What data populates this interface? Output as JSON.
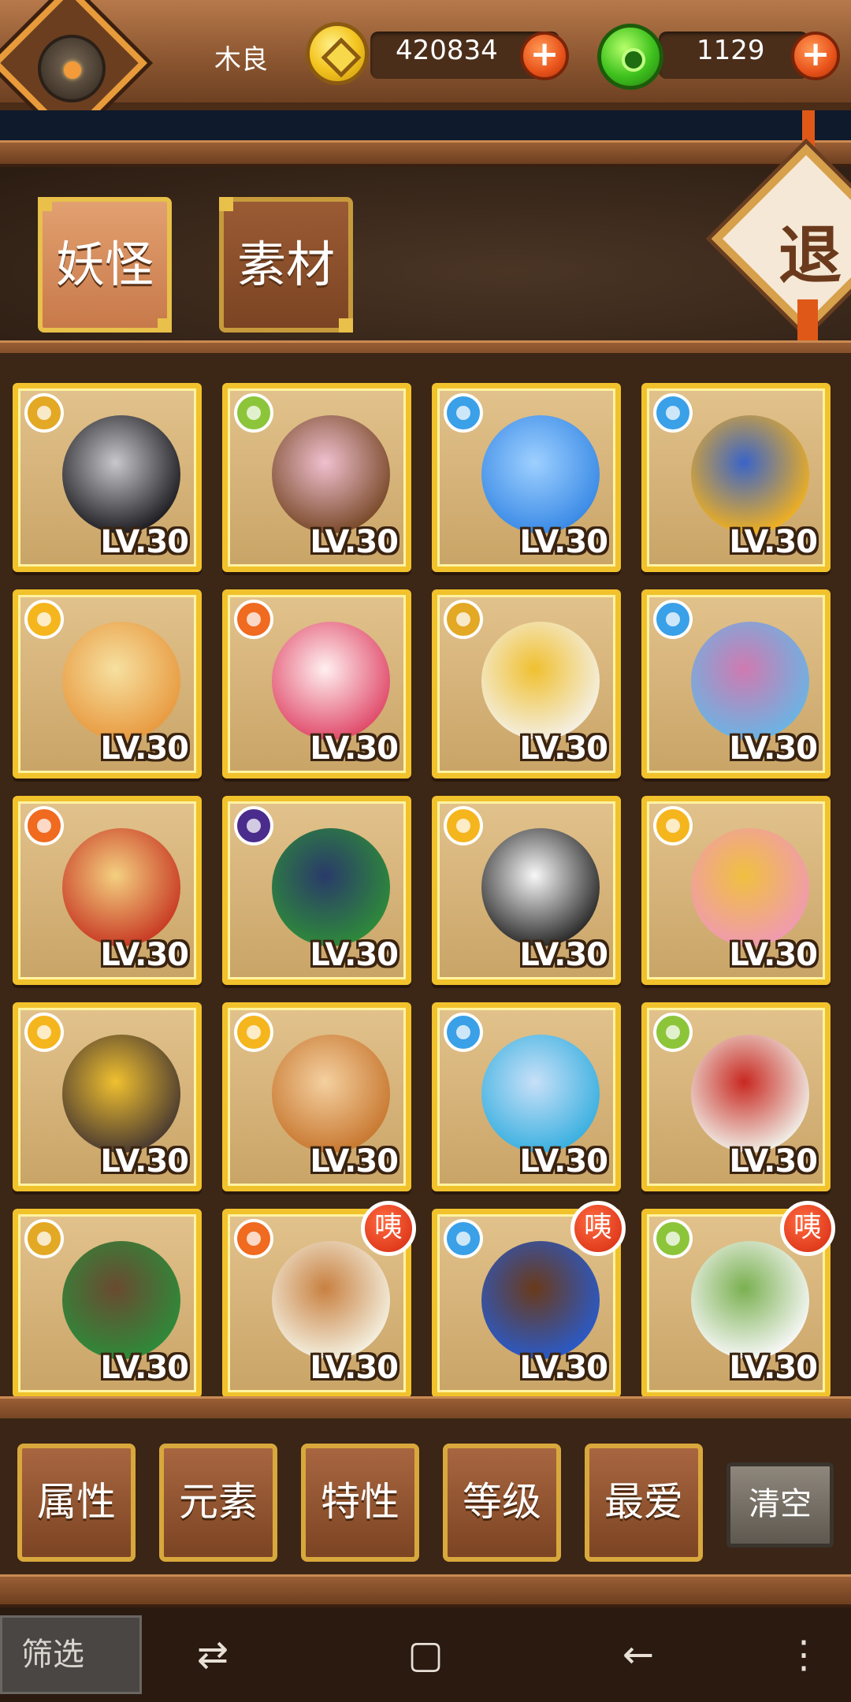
{
  "header": {
    "username": "木良",
    "coins": "420834",
    "gems": "1129",
    "coin_icon": "coin-icon",
    "gem_icon": "gem-icon"
  },
  "tabs": [
    {
      "label": "妖怪",
      "active": true
    },
    {
      "label": "素材",
      "active": false
    }
  ],
  "exit_label": "退",
  "cards": [
    {
      "element": "earth",
      "level": "LV.30",
      "new": false
    },
    {
      "element": "wood",
      "level": "LV.30",
      "new": false
    },
    {
      "element": "water",
      "level": "LV.30",
      "new": false
    },
    {
      "element": "water",
      "level": "LV.30",
      "new": false
    },
    {
      "element": "sun",
      "level": "LV.30",
      "new": false
    },
    {
      "element": "fire",
      "level": "LV.30",
      "new": false
    },
    {
      "element": "earth",
      "level": "LV.30",
      "new": false
    },
    {
      "element": "water",
      "level": "LV.30",
      "new": false
    },
    {
      "element": "fire",
      "level": "LV.30",
      "new": false
    },
    {
      "element": "dark",
      "level": "LV.30",
      "new": false
    },
    {
      "element": "sun",
      "level": "LV.30",
      "new": false
    },
    {
      "element": "sun",
      "level": "LV.30",
      "new": false
    },
    {
      "element": "sun",
      "level": "LV.30",
      "new": false
    },
    {
      "element": "sun",
      "level": "LV.30",
      "new": false
    },
    {
      "element": "water",
      "level": "LV.30",
      "new": false
    },
    {
      "element": "wood",
      "level": "LV.30",
      "new": false
    },
    {
      "element": "earth",
      "level": "LV.30",
      "new": false
    },
    {
      "element": "fire",
      "level": "LV.30",
      "new": true
    },
    {
      "element": "water",
      "level": "LV.30",
      "new": true
    },
    {
      "element": "wood",
      "level": "LV.30",
      "new": true
    }
  ],
  "new_badge": "咦",
  "filters": [
    "属性",
    "元素",
    "特性",
    "等级",
    "最爱"
  ],
  "clear_label": "清空",
  "bottom": {
    "filter_label": "筛选",
    "nav_icons": [
      "switch-apps-icon",
      "home-icon",
      "back-icon",
      "menu-icon"
    ]
  }
}
